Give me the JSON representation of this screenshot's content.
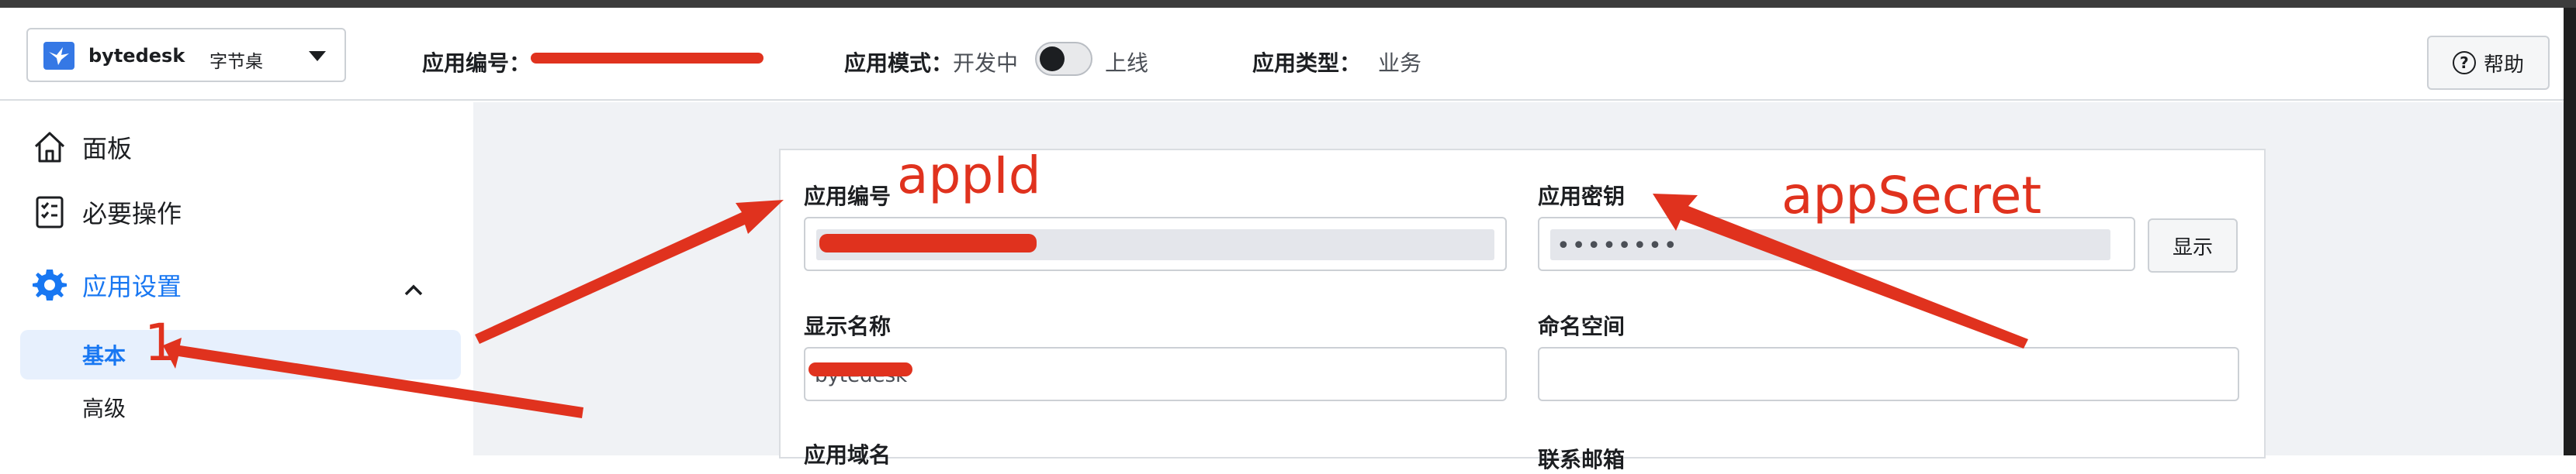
{
  "header": {
    "app_name": "bytedesk",
    "app_subtitle": "字节桌",
    "app_id_label": "应用编号：",
    "mode_label": "应用模式：",
    "mode_value": "开发中",
    "mode_toggle_on": false,
    "mode_online_label": "上线",
    "type_label": "应用类型：",
    "type_value": "业务",
    "help_label": "帮助"
  },
  "sidebar": {
    "items": [
      {
        "label": "面板",
        "icon": "home-icon"
      },
      {
        "label": "必要操作",
        "icon": "checklist-icon"
      },
      {
        "label": "应用设置",
        "icon": "gear-icon",
        "active": true,
        "expanded": true
      }
    ],
    "sub_items": [
      {
        "label": "基本",
        "active": true
      },
      {
        "label": "高级"
      }
    ]
  },
  "form": {
    "app_id_label": "应用编号",
    "app_secret_label": "应用密钥",
    "app_secret_value": "••••••••",
    "show_button": "显示",
    "display_name_label": "显示名称",
    "display_name_value": "bytedesk",
    "namespace_label": "命名空间",
    "namespace_value": "",
    "domain_label": "应用域名",
    "contact_label": "联系邮箱"
  },
  "annotations": {
    "app_id": "appId",
    "app_secret": "appSecret",
    "step_number": "1"
  },
  "colors": {
    "accent": "#1877f2",
    "annotation": "#e0321e",
    "page_bg": "#f0f2f5",
    "active_bg": "#e7f0fd"
  }
}
